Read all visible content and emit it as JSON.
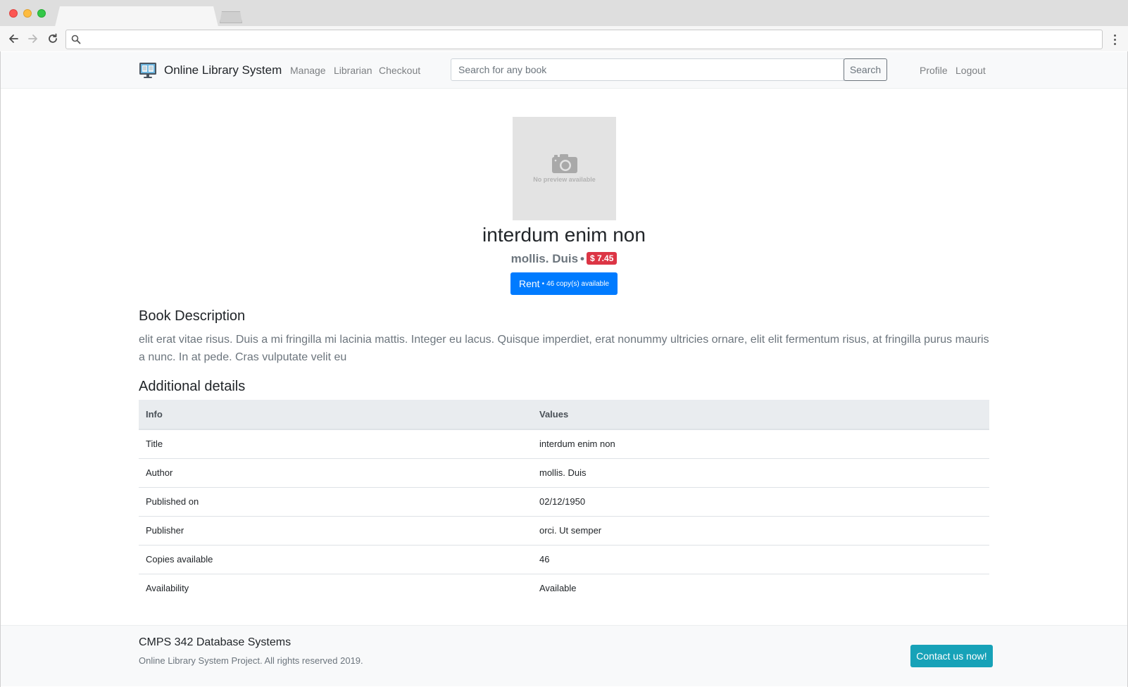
{
  "browser": {
    "url": ""
  },
  "navbar": {
    "brand": "Online Library System",
    "links": [
      "Manage",
      "Librarian",
      "Checkout"
    ],
    "search_placeholder": "Search for any book",
    "search_button": "Search",
    "right_links": [
      "Profile",
      "Logout"
    ]
  },
  "book": {
    "preview_text": "No preview available",
    "title": "interdum enim non",
    "author": "mollis. Duis",
    "separator": "•",
    "price": "$ 7.45",
    "rent_label": "Rent",
    "rent_copies": "46 copy(s) available"
  },
  "description": {
    "heading": "Book Description",
    "text": "elit erat vitae risus. Duis a mi fringilla mi lacinia mattis. Integer eu lacus. Quisque imperdiet, erat nonummy ultricies ornare, elit elit fermentum risus, at fringilla purus mauris a nunc. In at pede. Cras vulputate velit eu"
  },
  "details": {
    "heading": "Additional details",
    "columns": [
      "Info",
      "Values"
    ],
    "rows": [
      [
        "Title",
        "interdum enim non"
      ],
      [
        "Author",
        "mollis. Duis"
      ],
      [
        "Published on",
        "02/12/1950"
      ],
      [
        "Publisher",
        "orci. Ut semper"
      ],
      [
        "Copies available",
        "46"
      ],
      [
        "Availability",
        "Available"
      ]
    ]
  },
  "footer": {
    "title": "CMPS 342 Database Systems",
    "subtitle": "Online Library System Project. All rights reserved 2019.",
    "contact_button": "Contact us now!"
  },
  "colors": {
    "primary": "#007bff",
    "danger": "#dc3545",
    "info": "#17a2b8"
  }
}
